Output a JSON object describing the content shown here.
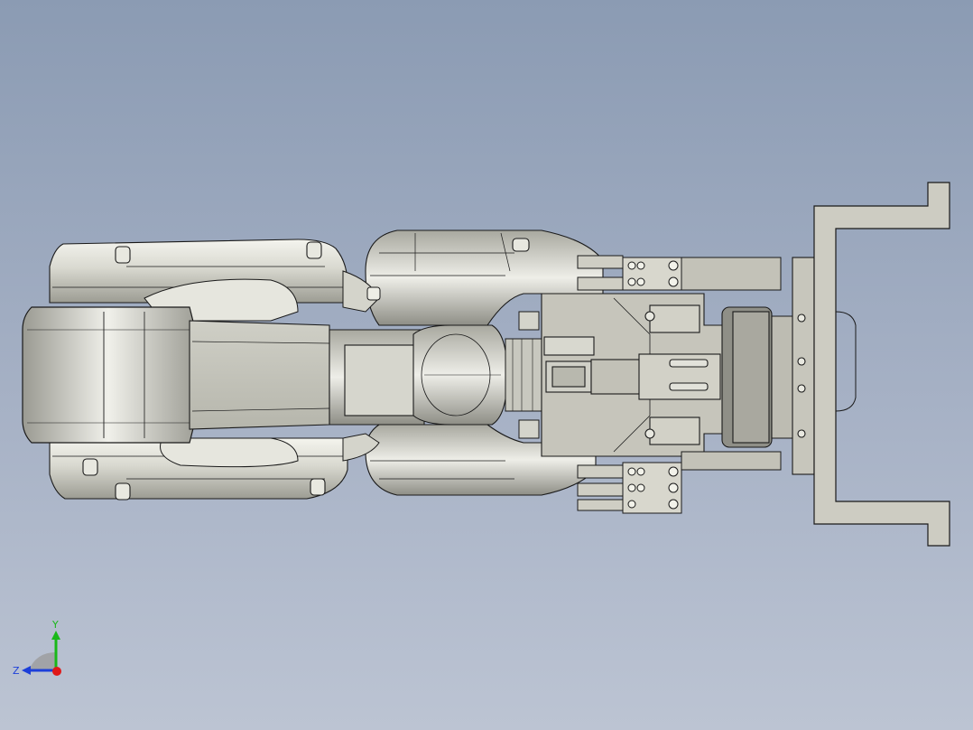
{
  "viewport": {
    "background_top": "#8b9bb3",
    "background_bottom": "#bcc4d3"
  },
  "model": {
    "shade_light": "#ebebe4",
    "shade_mid": "#c9c9bf",
    "shade_dark": "#7a7a72",
    "gripper_fill": "#c9c8be",
    "edge_color": "#1a1a1a"
  },
  "triad": {
    "y_label": "Y",
    "z_label": "Z",
    "y_color": "#19b819",
    "z_color": "#1c3fd9",
    "x_color": "#e01818"
  }
}
